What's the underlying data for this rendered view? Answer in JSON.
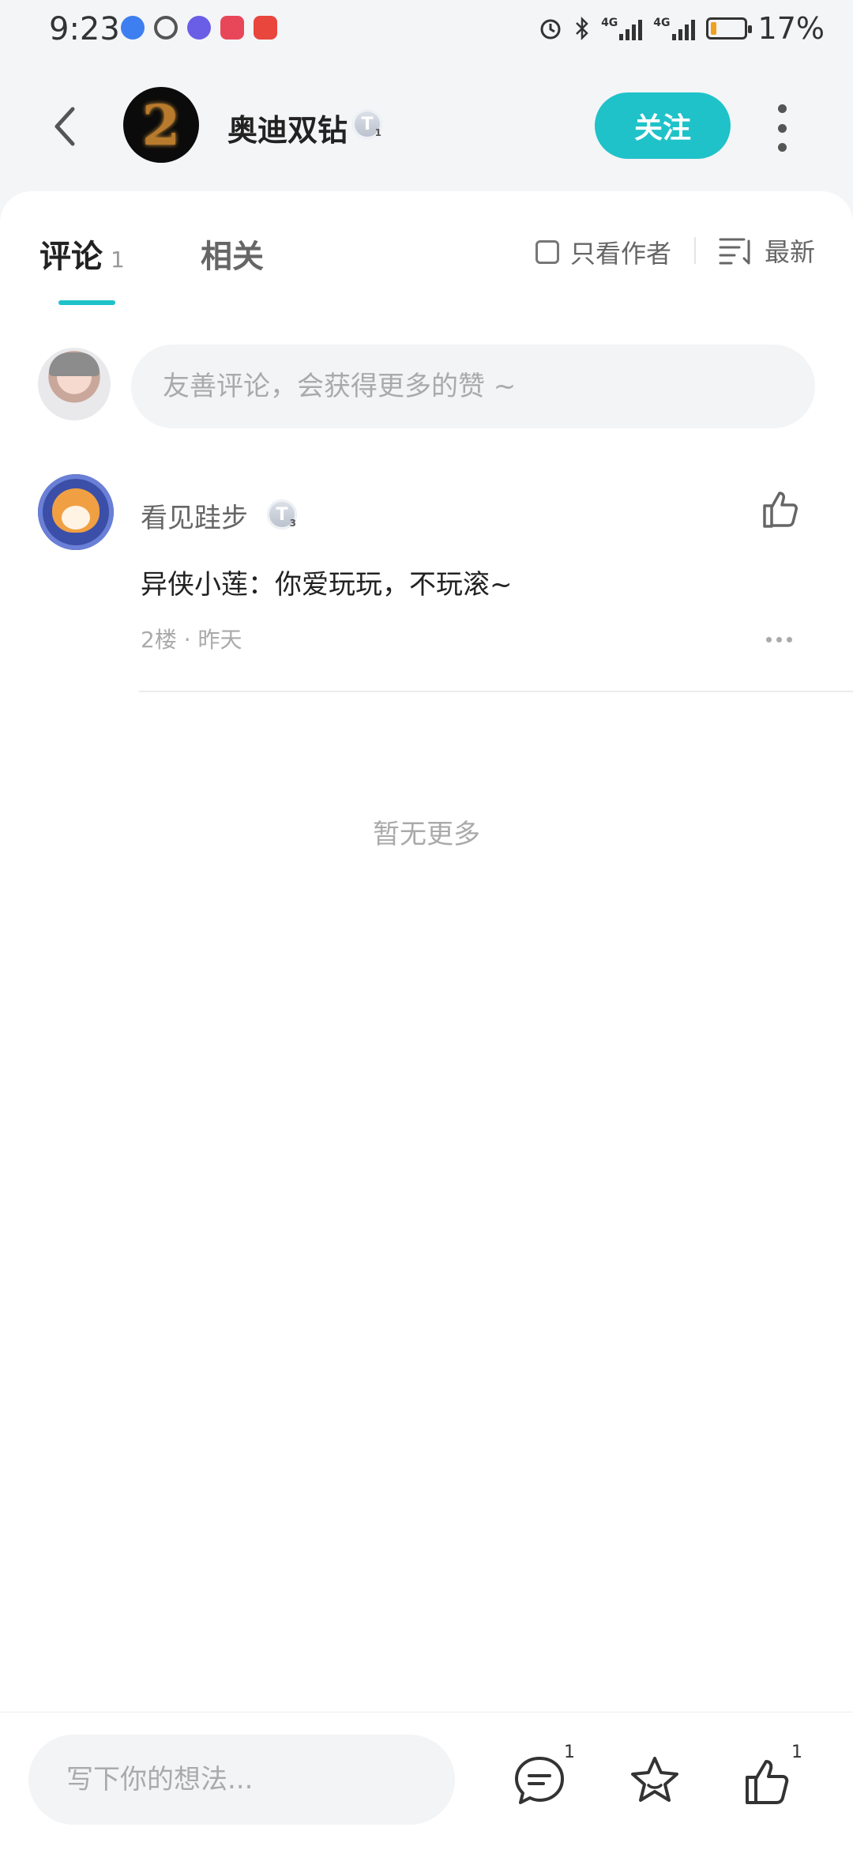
{
  "status_bar": {
    "time": "9:23",
    "network_1": "4G",
    "network_2": "4G",
    "battery": "17%",
    "battery_level": 0.17
  },
  "header": {
    "author_name": "奥迪双钻",
    "author_badge": "T",
    "author_badge_level": "1",
    "follow_label": "关注"
  },
  "tabs": {
    "comments_label": "评论",
    "comments_count": "1",
    "related_label": "相关",
    "author_only_label": "只看作者",
    "sort_label": "最新"
  },
  "comment_box": {
    "placeholder": "友善评论，会获得更多的赞 ~"
  },
  "comments": [
    {
      "author": "看见跬步",
      "badge": "T",
      "badge_level": "3",
      "text": "异侠小莲：你爱玩玩，不玩滚~",
      "floor": "2楼",
      "separator": "·",
      "time": "昨天"
    }
  ],
  "no_more_text": "暂无更多",
  "bottom_bar": {
    "placeholder": "写下你的想法...",
    "comment_count": "1",
    "like_count": "1"
  },
  "colors": {
    "accent": "#1fc2c9",
    "background": "#f4f5f7",
    "card": "#ffffff"
  }
}
